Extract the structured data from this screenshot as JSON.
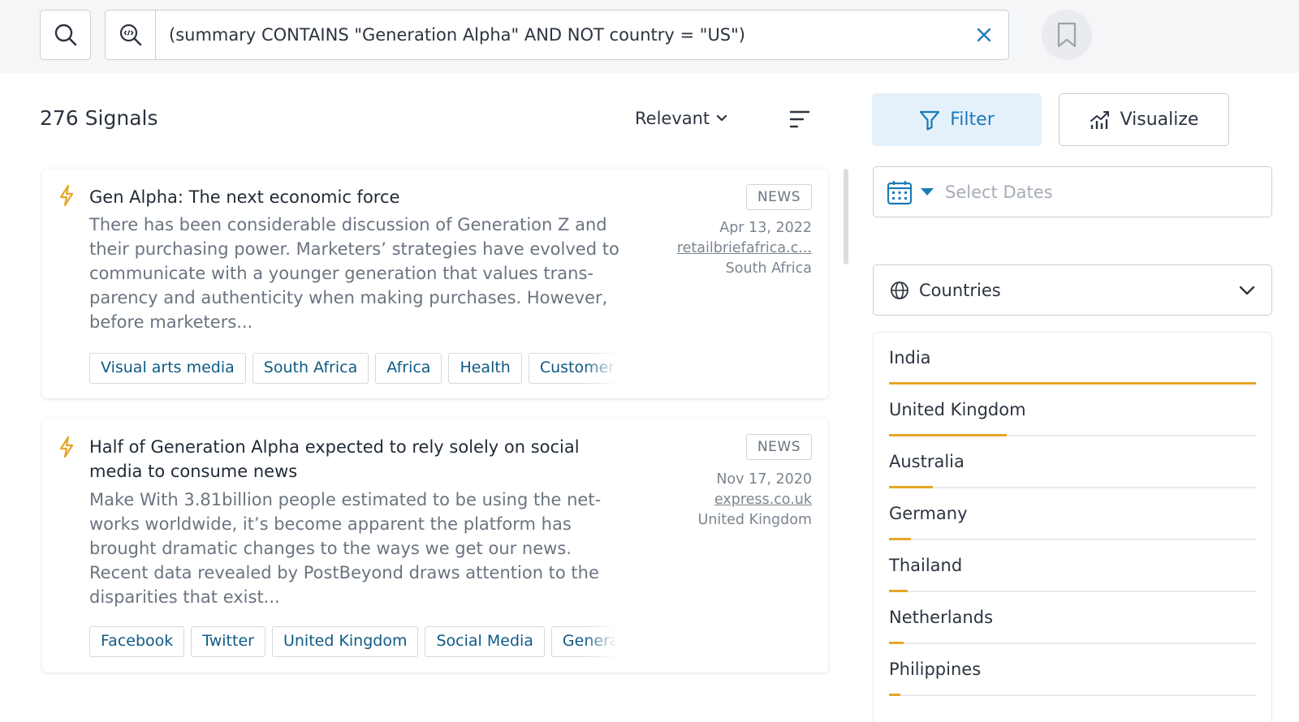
{
  "search": {
    "query": "(summary CONTAINS \"Generation Alpha\" AND NOT country = \"US\")"
  },
  "results": {
    "count_label": "276 Signals",
    "sort_label": "Relevant"
  },
  "signals": [
    {
      "title": "Gen Alpha: The next economic force",
      "summary": "There has been considerable discussion of Generation Z and their purchasing power. Marketers’ strategies have evolved to communicate with a younger generation that values trans-parency and authenticity when making purchases. However, before marketers...",
      "type": "NEWS",
      "date": "Apr 13, 2022",
      "source": "retailbriefafrica.c...",
      "country": "South Africa",
      "tags": [
        "Visual arts media",
        "South Africa",
        "Africa",
        "Health",
        "Customer"
      ]
    },
    {
      "title": "Half of Generation Alpha expected to rely solely on social media to consume news",
      "summary": "Make With 3.81billion people estimated to be using the net-works worldwide, it’s become apparent the platform has brought dramatic changes to the ways we get our news. Recent data revealed by PostBeyond draws attention to the disparities that exist...",
      "type": "NEWS",
      "date": "Nov 17, 2020",
      "source": "express.co.uk",
      "country": "United Kingdom",
      "tags": [
        "Facebook",
        "Twitter",
        "United Kingdom",
        "Social Media",
        "Generati"
      ]
    }
  ],
  "panel": {
    "filter_label": "Filter",
    "visualize_label": "Visualize",
    "dates_placeholder": "Select Dates",
    "countries_label": "Countries"
  },
  "countries": [
    {
      "name": "India",
      "share": 1.0
    },
    {
      "name": "United Kingdom",
      "share": 0.32
    },
    {
      "name": "Australia",
      "share": 0.12
    },
    {
      "name": "Germany",
      "share": 0.06
    },
    {
      "name": "Thailand",
      "share": 0.05
    },
    {
      "name": "Netherlands",
      "share": 0.04
    },
    {
      "name": "Philippines",
      "share": 0.03
    }
  ],
  "colors": {
    "accent": "#1c7ab8",
    "bar": "#e6a627",
    "bolt": "#e6a627"
  }
}
